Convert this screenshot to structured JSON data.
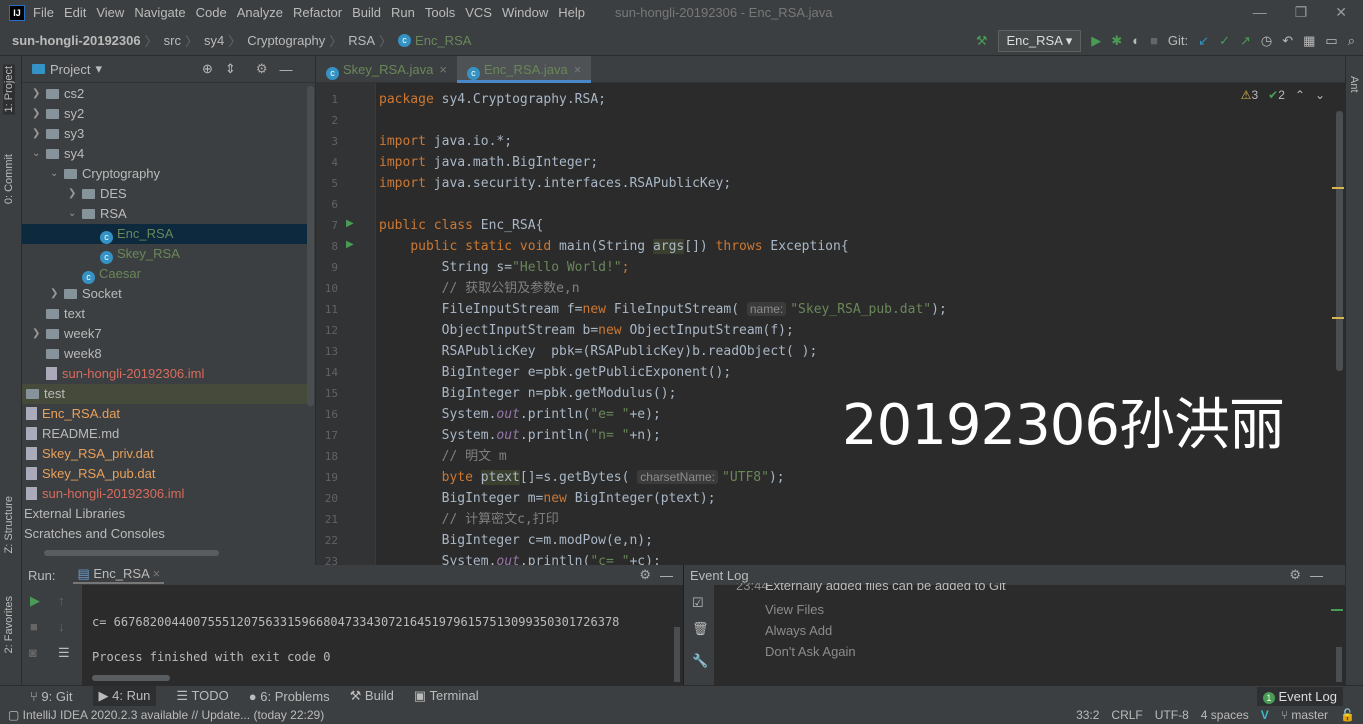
{
  "menu": {
    "items": [
      "File",
      "Edit",
      "View",
      "Navigate",
      "Code",
      "Analyze",
      "Refactor",
      "Build",
      "Run",
      "Tools",
      "VCS",
      "Window",
      "Help"
    ],
    "window_title": "sun-hongli-20192306 - Enc_RSA.java"
  },
  "nav": {
    "breadcrumb": [
      "sun-hongli-20192306",
      "src",
      "sy4",
      "Cryptography",
      "RSA",
      "Enc_RSA"
    ],
    "run_config": "Enc_RSA",
    "git_label": "Git:"
  },
  "left_strip": {
    "project": "1: Project",
    "commit": "0: Commit",
    "structure": "Z: Structure",
    "favorites": "2: Favorites"
  },
  "right_strip": {
    "ant": "Ant"
  },
  "project": {
    "title": "Project",
    "tree": [
      {
        "label": "cs2",
        "level": 1,
        "type": "folder",
        "arrow": "›"
      },
      {
        "label": "sy2",
        "level": 1,
        "type": "folder",
        "arrow": "›"
      },
      {
        "label": "sy3",
        "level": 1,
        "type": "folder",
        "arrow": "›"
      },
      {
        "label": "sy4",
        "level": 1,
        "type": "folder",
        "arrow": "⌄"
      },
      {
        "label": "Cryptography",
        "level": 2,
        "type": "folder",
        "arrow": "⌄"
      },
      {
        "label": "DES",
        "level": 3,
        "type": "folder",
        "arrow": "›"
      },
      {
        "label": "RSA",
        "level": 3,
        "type": "folder",
        "arrow": "⌄"
      },
      {
        "label": "Enc_RSA",
        "level": 4,
        "type": "class",
        "state": "selected"
      },
      {
        "label": "Skey_RSA",
        "level": 4,
        "type": "class"
      },
      {
        "label": "Caesar",
        "level": 3,
        "type": "class"
      },
      {
        "label": "Socket",
        "level": 2,
        "type": "folder",
        "arrow": "›"
      },
      {
        "label": "text",
        "level": 1,
        "type": "folder"
      },
      {
        "label": "week7",
        "level": 1,
        "type": "folder",
        "arrow": "›"
      },
      {
        "label": "week8",
        "level": 1,
        "type": "folder"
      },
      {
        "label": "sun-hongli-20192306.iml",
        "level": 1,
        "type": "iml"
      },
      {
        "label": "test",
        "level": 0,
        "type": "folder",
        "state": "highlight"
      },
      {
        "label": "Enc_RSA.dat",
        "level": 0,
        "type": "dat"
      },
      {
        "label": "README.md",
        "level": 0,
        "type": "md"
      },
      {
        "label": "Skey_RSA_priv.dat",
        "level": 0,
        "type": "dat"
      },
      {
        "label": "Skey_RSA_pub.dat",
        "level": 0,
        "type": "dat"
      },
      {
        "label": "sun-hongli-20192306.iml",
        "level": 0,
        "type": "iml"
      },
      {
        "label": "External Libraries",
        "level": -1,
        "type": "lib"
      },
      {
        "label": "Scratches and Consoles",
        "level": -1,
        "type": "lib"
      }
    ]
  },
  "editor": {
    "tabs": [
      {
        "label": "Skey_RSA.java",
        "active": false
      },
      {
        "label": "Enc_RSA.java",
        "active": true
      }
    ],
    "inspections": {
      "warnings": "3",
      "ok": "2"
    },
    "lines": [
      [
        [
          "k",
          "package "
        ],
        [
          "p",
          "sy4.Cryptography.RSA;"
        ]
      ],
      [],
      [
        [
          "k",
          "import "
        ],
        [
          "p",
          "java.io.*;"
        ]
      ],
      [
        [
          "k",
          "import "
        ],
        [
          "p",
          "java.math.BigInteger;"
        ]
      ],
      [
        [
          "k",
          "import "
        ],
        [
          "p",
          "java.security.interfaces.RSAPublicKey;"
        ]
      ],
      [],
      [
        [
          "k",
          "public class "
        ],
        [
          "p",
          "Enc_RSA{"
        ]
      ],
      [
        [
          "p",
          "    "
        ],
        [
          "k",
          "public static void "
        ],
        [
          "p",
          "main(String "
        ],
        [
          "bg",
          "args"
        ],
        [
          "p",
          "[]) "
        ],
        [
          "k",
          "throws "
        ],
        [
          "p",
          "Exception{"
        ]
      ],
      [
        [
          "p",
          "        String s="
        ],
        [
          "s",
          "\"Hello World!\""
        ],
        [
          "k",
          ";"
        ]
      ],
      [
        [
          "c",
          "        // 获取公钥及参数e,n"
        ]
      ],
      [
        [
          "p",
          "        FileInputStream f="
        ],
        [
          "k",
          "new "
        ],
        [
          "p",
          "FileInputStream( "
        ],
        [
          "h",
          "name:"
        ],
        [
          "s",
          "\"Skey_RSA_pub.dat\""
        ],
        [
          "p",
          ");"
        ]
      ],
      [
        [
          "p",
          "        ObjectInputStream b="
        ],
        [
          "k",
          "new "
        ],
        [
          "p",
          "ObjectInputStream(f);"
        ]
      ],
      [
        [
          "p",
          "        RSAPublicKey  pbk=(RSAPublicKey)b.readObject( );"
        ]
      ],
      [
        [
          "p",
          "        BigInteger e=pbk.getPublicExponent();"
        ]
      ],
      [
        [
          "p",
          "        BigInteger n=pbk.getModulus();"
        ]
      ],
      [
        [
          "p",
          "        System."
        ],
        [
          "i",
          "out"
        ],
        [
          "p",
          ".println("
        ],
        [
          "s",
          "\"e= \""
        ],
        [
          "p",
          "+e);"
        ]
      ],
      [
        [
          "p",
          "        System."
        ],
        [
          "i",
          "out"
        ],
        [
          "p",
          ".println("
        ],
        [
          "s",
          "\"n= \""
        ],
        [
          "p",
          "+n);"
        ]
      ],
      [
        [
          "c",
          "        // 明文 m"
        ]
      ],
      [
        [
          "k",
          "        byte "
        ],
        [
          "bg",
          "ptext"
        ],
        [
          "p",
          "[]=s.getBytes( "
        ],
        [
          "h",
          "charsetName:"
        ],
        [
          "s",
          "\"UTF8\""
        ],
        [
          "p",
          ");"
        ]
      ],
      [
        [
          "p",
          "        BigInteger m="
        ],
        [
          "k",
          "new "
        ],
        [
          "p",
          "BigInteger(ptext);"
        ]
      ],
      [
        [
          "c",
          "        // 计算密文c,打印"
        ]
      ],
      [
        [
          "p",
          "        BigInteger c=m.modPow(e,n);"
        ]
      ],
      [
        [
          "p",
          "        System."
        ],
        [
          "i",
          "out"
        ],
        [
          "p",
          ".println("
        ],
        [
          "s",
          "\"c= \""
        ],
        [
          "p",
          "+c);"
        ]
      ]
    ],
    "run_markers": [
      7,
      8
    ]
  },
  "watermark": "20192306孙洪丽",
  "run": {
    "label": "Run:",
    "tab": "Enc_RSA",
    "output": [
      "c= 6676820044007555120756331596680473343072164519796157513099350301726378",
      "",
      "Process finished with exit code 0"
    ]
  },
  "event_log": {
    "title": "Event Log",
    "time": "23:44",
    "message": "Externally added files can be added to Git",
    "actions": [
      "View Files",
      "Always Add",
      "Don't Ask Again"
    ]
  },
  "bottom_tools": [
    "9: Git",
    "4: Run",
    "TODO",
    "6: Problems",
    "Build",
    "Terminal"
  ],
  "bottom_right": {
    "event_log": "Event Log",
    "badge": "1"
  },
  "status": {
    "message": "IntelliJ IDEA 2020.2.3 available // Update... (today 22:29)",
    "position": "33:2",
    "line_sep": "CRLF",
    "encoding": "UTF-8",
    "indent": "4 spaces",
    "branch": "master"
  },
  "colors": {
    "keyword": "#cc7832",
    "string": "#6a8759",
    "comment": "#808080",
    "accent": "#4a88c7"
  }
}
